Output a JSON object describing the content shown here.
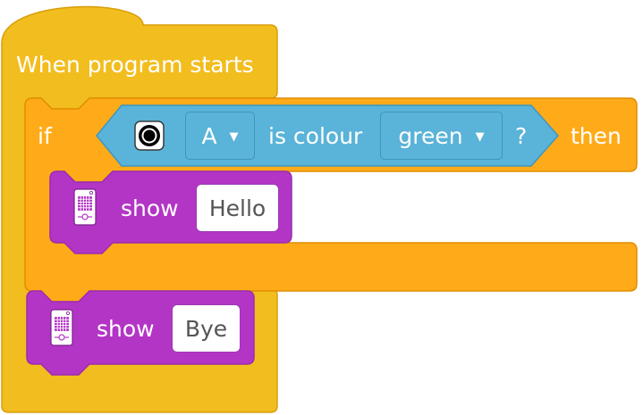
{
  "hat_block": {
    "label": "When program starts"
  },
  "if_block": {
    "if_label": "if",
    "then_label": "then",
    "condition": {
      "port": "A",
      "text": "is colour",
      "color_value": "green",
      "question": "?"
    },
    "body": {
      "show_label": "show",
      "value": "Hello"
    }
  },
  "show_block": {
    "show_label": "show",
    "value": "Bye"
  },
  "icons": {
    "color_sensor": "color-sensor-icon",
    "light_matrix": "light-matrix-icon",
    "dropdown": "caret-down-icon"
  },
  "colors": {
    "events": "#f2bd1e",
    "control": "#ffab19",
    "sensors": "#5ab3d8",
    "display": "#b335c5"
  }
}
